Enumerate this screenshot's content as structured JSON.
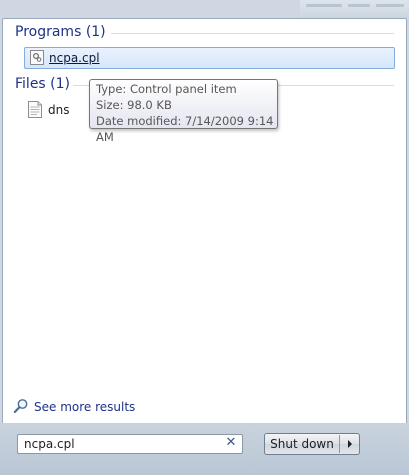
{
  "programs": {
    "header": "Programs (1)",
    "items": [
      {
        "label": "ncpa.cpl",
        "icon": "control-panel-icon"
      }
    ]
  },
  "files": {
    "header": "Files (1)",
    "items": [
      {
        "label": "dns",
        "icon": "text-file-icon"
      }
    ]
  },
  "tooltip": {
    "type": "Type: Control panel item",
    "size": "Size: 98.0 KB",
    "date": "Date modified: 7/14/2009 9:14 AM"
  },
  "more_results": {
    "label": "See more results",
    "icon": "magnifier-icon"
  },
  "search": {
    "value": "ncpa.cpl",
    "clear_icon": "clear-icon"
  },
  "shutdown": {
    "label": "Shut down",
    "arrow_icon": "arrow-right-icon"
  },
  "colors": {
    "header": "#1e3287",
    "highlight": "#d5e6fb",
    "bar": "#c9d3de"
  }
}
